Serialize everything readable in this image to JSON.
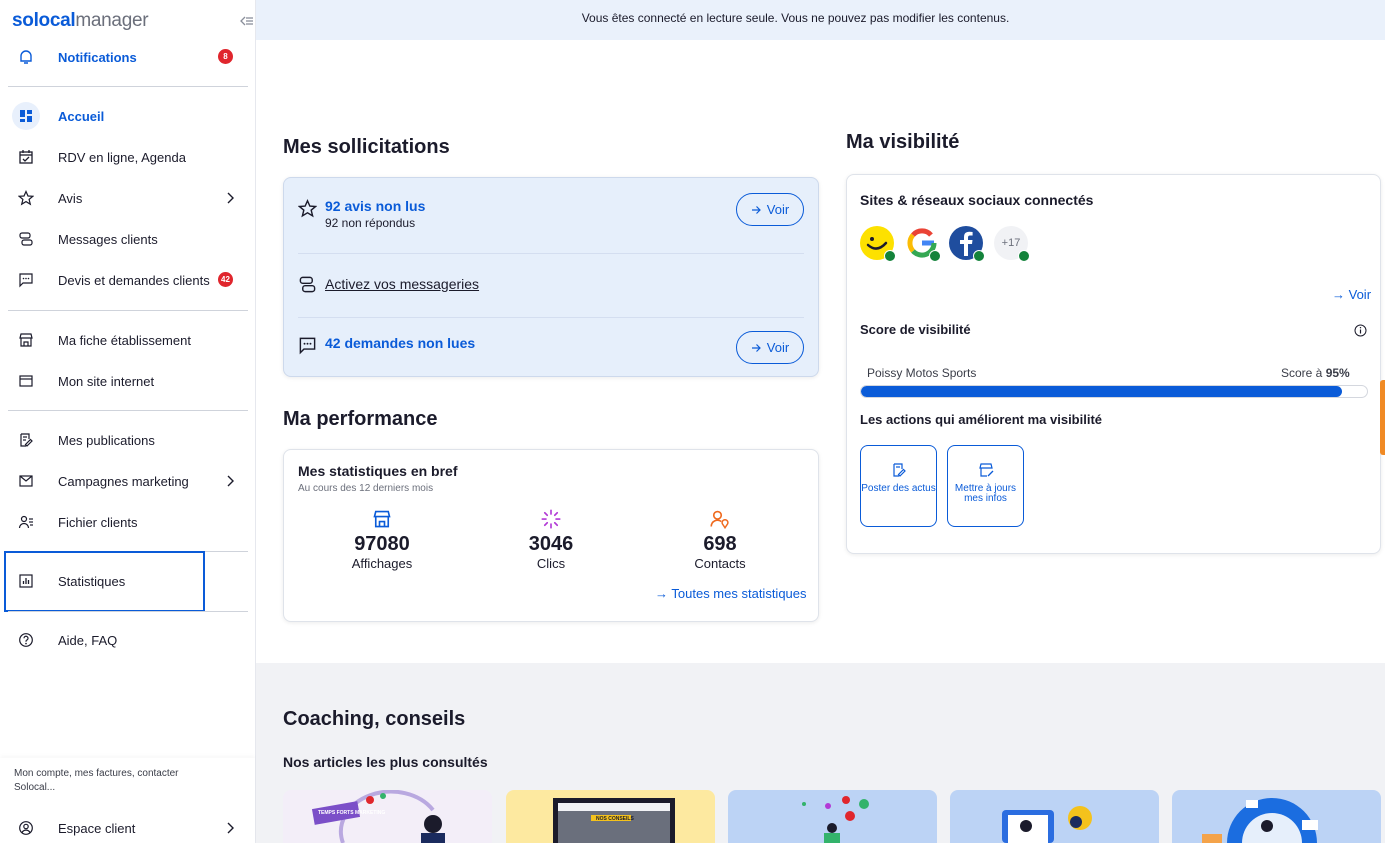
{
  "app": {
    "logo_part1": "solocal",
    "logo_part2": "manager",
    "readonly_banner": "Vous êtes connecté en lecture seule. Vous ne pouvez pas modifier les contenus."
  },
  "sidebar": {
    "notifications": {
      "label": "Notifications",
      "badge": "8"
    },
    "items": [
      {
        "label": "Accueil"
      },
      {
        "label": "RDV en ligne, Agenda"
      },
      {
        "label": "Avis"
      },
      {
        "label": "Messages clients"
      },
      {
        "label": "Devis et demandes clients",
        "badge": "42"
      },
      {
        "label": "Ma fiche établissement"
      },
      {
        "label": "Mon site internet"
      },
      {
        "label": "Mes publications"
      },
      {
        "label": "Campagnes marketing"
      },
      {
        "label": "Fichier clients"
      },
      {
        "label": "Statistiques"
      },
      {
        "label": "Aide, FAQ"
      }
    ],
    "account_text": "Mon compte, mes factures, contacter Solocal...",
    "account_item": "Espace client"
  },
  "sollicitations": {
    "title": "Mes sollicitations",
    "avis_title": "92 avis non lus",
    "avis_sub": "92 non répondus",
    "voir": "Voir",
    "messageries": "Activez vos messageries",
    "demandes": "42 demandes non lues"
  },
  "performance": {
    "title": "Ma performance",
    "card_title": "Mes statistiques en bref",
    "card_sub": "Au cours des 12 derniers mois",
    "stats": [
      {
        "value": "97080",
        "label": "Affichages"
      },
      {
        "value": "3046",
        "label": "Clics"
      },
      {
        "value": "698",
        "label": "Contacts"
      }
    ],
    "link": "Toutes mes statistiques"
  },
  "visibilite": {
    "title": "Ma visibilité",
    "sites_title": "Sites & réseaux sociaux connectés",
    "more_count": "+17",
    "voir": "Voir",
    "score_title": "Score de visibilité",
    "business_name": "Poissy Motos Sports",
    "score_prefix": "Score à",
    "score_value": "95%",
    "score_fraction": 0.95,
    "actions_title": "Les actions qui améliorent ma visibilité",
    "actions": [
      {
        "label": "Poster des actus"
      },
      {
        "label": "Mettre à jours mes infos"
      }
    ]
  },
  "coaching": {
    "title": "Coaching, conseils",
    "subtitle": "Nos articles les plus consultés",
    "article1_caption": "TEMPS FORTS MARKETING",
    "article2_caption": "NOS CONSEILS"
  },
  "colors": {
    "accent": "#0a5bd8",
    "badge_red": "#e0262d",
    "check_green": "#14833b"
  }
}
